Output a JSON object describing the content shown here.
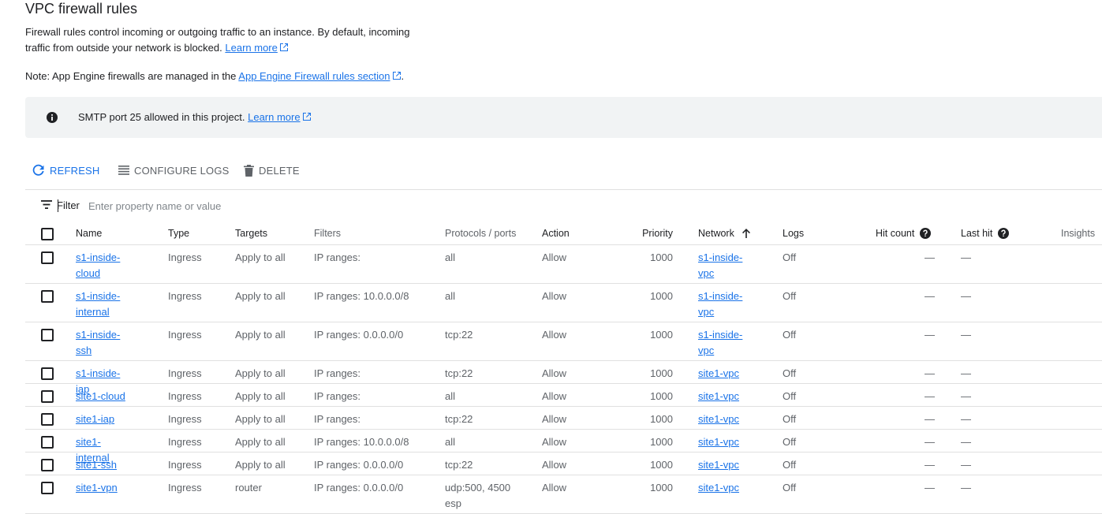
{
  "page": {
    "title": "VPC firewall rules",
    "description": "Firewall rules control incoming or outgoing traffic to an instance. By default, incoming traffic from outside your network is blocked.",
    "learn_more": "Learn more",
    "note_prefix": "Note: App Engine firewalls are managed in the",
    "note_link": "App Engine Firewall rules section",
    "note_suffix": "."
  },
  "banner": {
    "text": "SMTP port 25 allowed in this project.",
    "link": "Learn more",
    "icon": "info-icon"
  },
  "toolbar": {
    "refresh": "REFRESH",
    "configure_logs": "CONFIGURE LOGS",
    "delete": "DELETE"
  },
  "filter": {
    "label": "Filter",
    "placeholder": "Enter property name or value"
  },
  "columns": {
    "name": "Name",
    "type": "Type",
    "targets": "Targets",
    "filters": "Filters",
    "protocols": "Protocols / ports",
    "action": "Action",
    "priority": "Priority",
    "network": "Network",
    "logs": "Logs",
    "hit_count": "Hit count",
    "last_hit": "Last hit",
    "insights": "Insights"
  },
  "sort": {
    "column": "Network",
    "direction": "ascending"
  },
  "rows": [
    {
      "name": "s1-inside-cloud",
      "type": "Ingress",
      "targets": "Apply to all",
      "filters": "IP ranges:",
      "protocols": "all",
      "action": "Allow",
      "priority": "1000",
      "network": "s1-inside-vpc",
      "logs": "Off",
      "hit_count": "—",
      "last_hit": "—"
    },
    {
      "name": "s1-inside-internal",
      "type": "Ingress",
      "targets": "Apply to all",
      "filters": "IP ranges: 10.0.0.0/8",
      "protocols": "all",
      "action": "Allow",
      "priority": "1000",
      "network": "s1-inside-vpc",
      "logs": "Off",
      "hit_count": "—",
      "last_hit": "—"
    },
    {
      "name": "s1-inside-ssh",
      "type": "Ingress",
      "targets": "Apply to all",
      "filters": "IP ranges: 0.0.0.0/0",
      "protocols": "tcp:22",
      "action": "Allow",
      "priority": "1000",
      "network": "s1-inside-vpc",
      "logs": "Off",
      "hit_count": "—",
      "last_hit": "—"
    },
    {
      "name": "s1-inside-iap",
      "type": "Ingress",
      "targets": "Apply to all",
      "filters": "IP ranges:",
      "protocols": "tcp:22",
      "action": "Allow",
      "priority": "1000",
      "network": "site1-vpc",
      "logs": "Off",
      "hit_count": "—",
      "last_hit": "—"
    },
    {
      "name": "site1-cloud",
      "type": "Ingress",
      "targets": "Apply to all",
      "filters": "IP ranges:",
      "protocols": "all",
      "action": "Allow",
      "priority": "1000",
      "network": "site1-vpc",
      "logs": "Off",
      "hit_count": "—",
      "last_hit": "—"
    },
    {
      "name": "site1-iap",
      "type": "Ingress",
      "targets": "Apply to all",
      "filters": "IP ranges:",
      "protocols": "tcp:22",
      "action": "Allow",
      "priority": "1000",
      "network": "site1-vpc",
      "logs": "Off",
      "hit_count": "—",
      "last_hit": "—"
    },
    {
      "name": "site1-internal",
      "type": "Ingress",
      "targets": "Apply to all",
      "filters": "IP ranges: 10.0.0.0/8",
      "protocols": "all",
      "action": "Allow",
      "priority": "1000",
      "network": "site1-vpc",
      "logs": "Off",
      "hit_count": "—",
      "last_hit": "—"
    },
    {
      "name": "site1-ssh",
      "type": "Ingress",
      "targets": "Apply to all",
      "filters": "IP ranges: 0.0.0.0/0",
      "protocols": "tcp:22",
      "action": "Allow",
      "priority": "1000",
      "network": "site1-vpc",
      "logs": "Off",
      "hit_count": "—",
      "last_hit": "—"
    },
    {
      "name": "site1-vpn",
      "type": "Ingress",
      "targets": "router",
      "filters": "IP ranges: 0.0.0.0/0",
      "protocols": "udp:500, 4500 esp",
      "action": "Allow",
      "priority": "1000",
      "network": "site1-vpc",
      "logs": "Off",
      "hit_count": "—",
      "last_hit": "—"
    }
  ],
  "colors": {
    "link": "#1a73e8",
    "text": "#202124",
    "secondary_text": "#5f6368",
    "banner_bg": "#f1f3f4",
    "divider": "#e0e0e0"
  }
}
